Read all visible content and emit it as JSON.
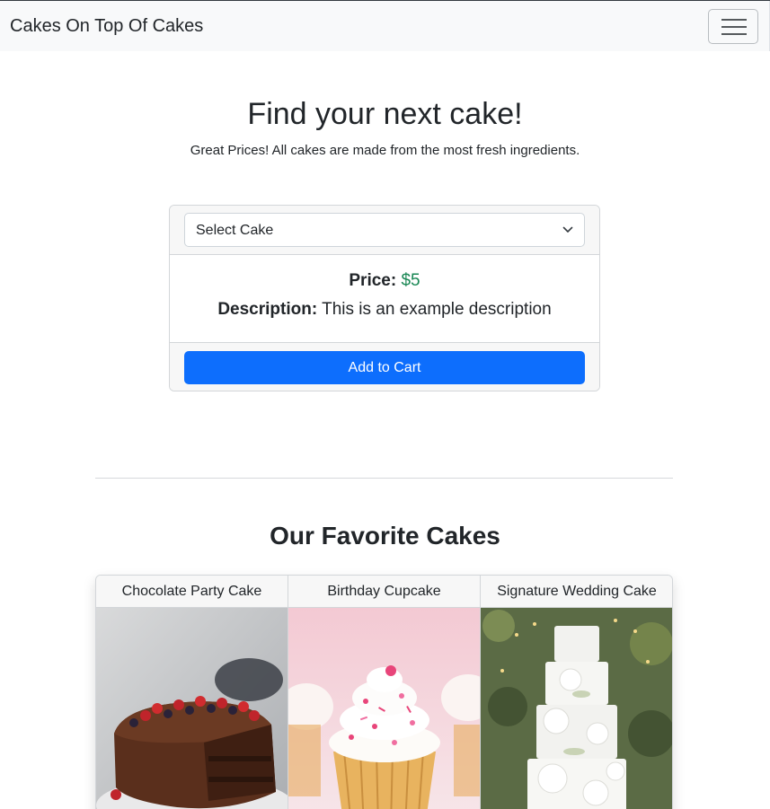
{
  "navbar": {
    "brand": "Cakes On Top Of Cakes",
    "toggler_icon": "hamburger-menu-icon"
  },
  "hero": {
    "title": "Find your next cake!",
    "subtitle": "Great Prices! All cakes are made from the most fresh ingredients."
  },
  "product_card": {
    "select": {
      "selected": "Select Cake",
      "icon": "chevron-down-icon"
    },
    "price_label": "Price:",
    "price_value": "$5",
    "description_label": "Description:",
    "description_value": "This is an example description",
    "add_button": "Add to Cart"
  },
  "favorites": {
    "title": "Our Favorite Cakes",
    "cakes": [
      {
        "name": "Chocolate Party Cake"
      },
      {
        "name": "Birthday Cupcake"
      },
      {
        "name": "Signature Wedding Cake"
      }
    ]
  },
  "colors": {
    "primary": "#0d6efd",
    "price_green": "#198754",
    "navbar_bg": "#f8f9fa"
  }
}
